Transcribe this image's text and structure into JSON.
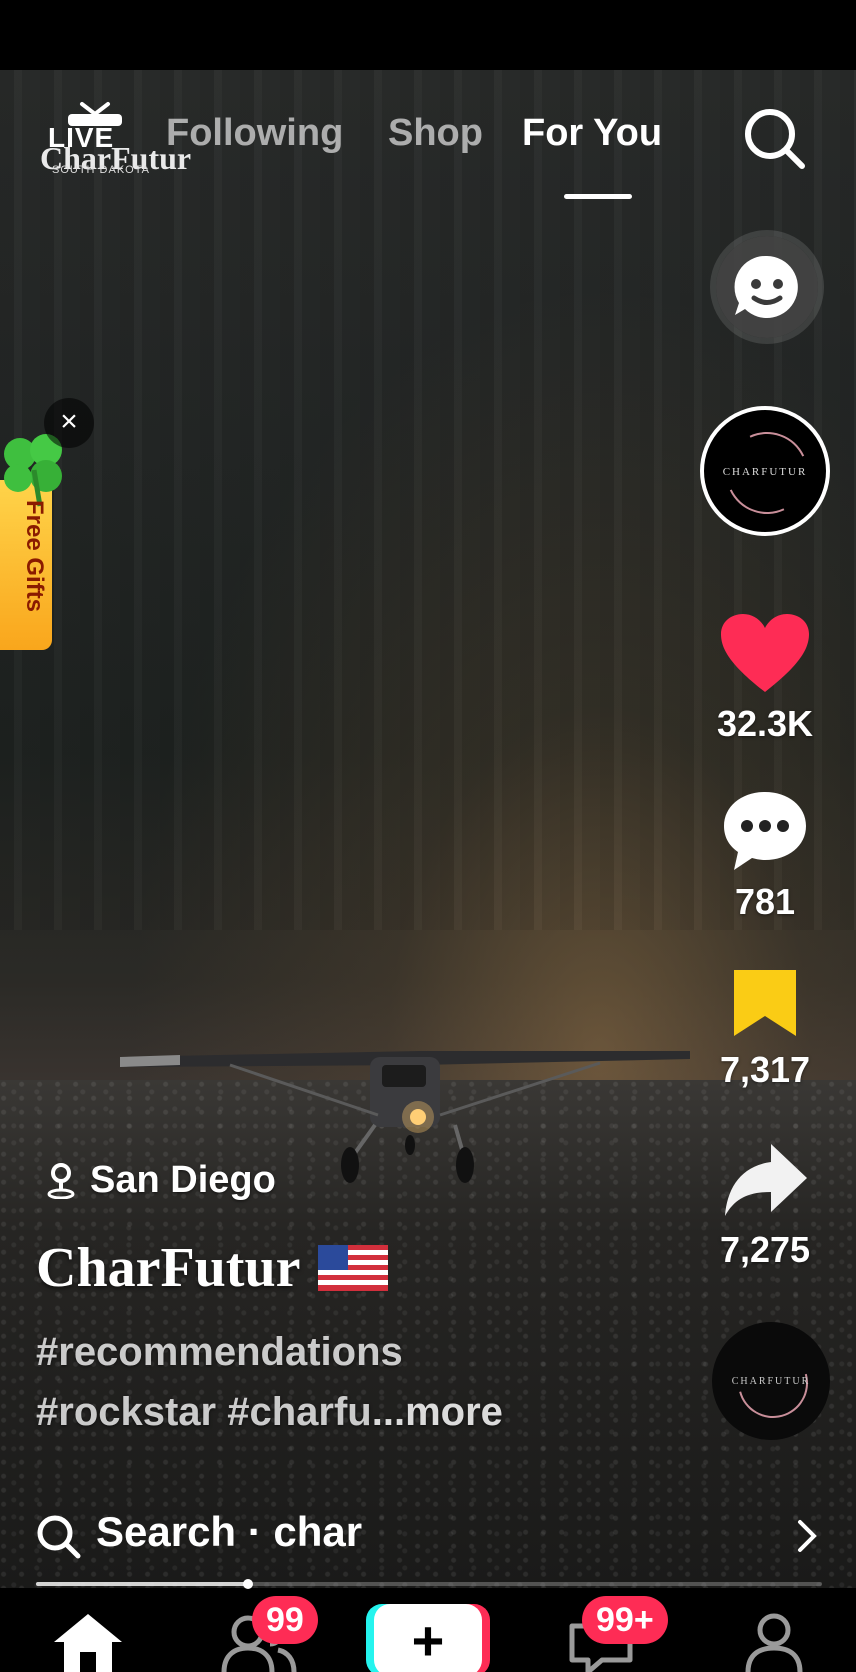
{
  "header": {
    "live_badge": "LIVE",
    "live_brand": "CharFutur",
    "live_sub": "SOUTH DAKOTA",
    "tabs": [
      {
        "label": "Following",
        "active": false
      },
      {
        "label": "Shop",
        "active": false
      },
      {
        "label": "For You",
        "active": true
      }
    ],
    "search_icon": "search-icon"
  },
  "promo": {
    "label": "Free Gifts",
    "close_symbol": "×",
    "icon": "clover-icon"
  },
  "creator": {
    "avatar_text": "CHARFUTUR",
    "username": "CharFutur",
    "flag": "us-flag-icon"
  },
  "actions": {
    "likes": "32.3K",
    "comments": "781",
    "saves": "7,317",
    "shares": "7,275"
  },
  "video": {
    "location": "San Diego",
    "caption_line1": "#recommendations",
    "caption_line2": "#rockstar #charfu",
    "more_label": "...more",
    "progress": 0.27,
    "music_disc_text": "CHARFUTUR"
  },
  "search_suggestion": {
    "label": "Search · char"
  },
  "bottom_nav": {
    "friends_badge": "99",
    "inbox_badge": "99+",
    "create_label": "+"
  },
  "colors": {
    "like": "#fe2c55",
    "save": "#facc15",
    "badge": "#fe2c55",
    "accent_cyan": "#25f4ee"
  }
}
